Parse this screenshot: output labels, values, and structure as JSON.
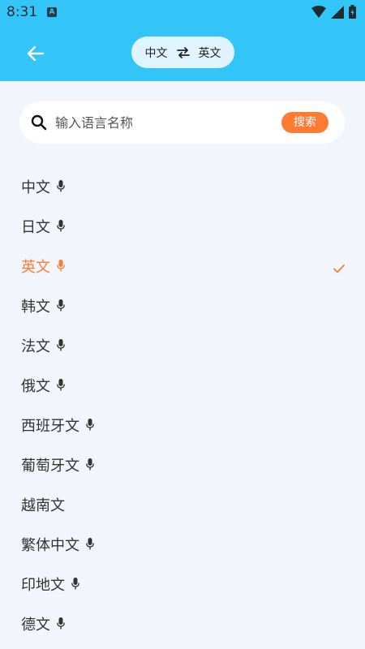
{
  "status": {
    "time": "8:31",
    "notification_letter": "A"
  },
  "header": {
    "source_lang": "中文",
    "target_lang": "英文"
  },
  "search": {
    "placeholder": "输入语言名称",
    "button_label": "搜索"
  },
  "languages": [
    {
      "label": "中文",
      "mic": true,
      "selected": false
    },
    {
      "label": "日文",
      "mic": true,
      "selected": false
    },
    {
      "label": "英文",
      "mic": true,
      "selected": true
    },
    {
      "label": "韩文",
      "mic": true,
      "selected": false
    },
    {
      "label": "法文",
      "mic": true,
      "selected": false
    },
    {
      "label": "俄文",
      "mic": true,
      "selected": false
    },
    {
      "label": "西班牙文",
      "mic": true,
      "selected": false
    },
    {
      "label": "葡萄牙文",
      "mic": true,
      "selected": false
    },
    {
      "label": "越南文",
      "mic": false,
      "selected": false
    },
    {
      "label": "繁体中文",
      "mic": true,
      "selected": false
    },
    {
      "label": "印地文",
      "mic": true,
      "selected": false
    },
    {
      "label": "德文",
      "mic": true,
      "selected": false
    }
  ],
  "colors": {
    "header_bg": "#33c5f7",
    "accent": "#ff7a33",
    "page_bg": "#f2f5fc"
  },
  "icons": {
    "back": "arrow-left-icon",
    "swap": "swap-arrows-icon",
    "search": "search-icon",
    "mic": "mic-icon",
    "check": "check-icon"
  }
}
